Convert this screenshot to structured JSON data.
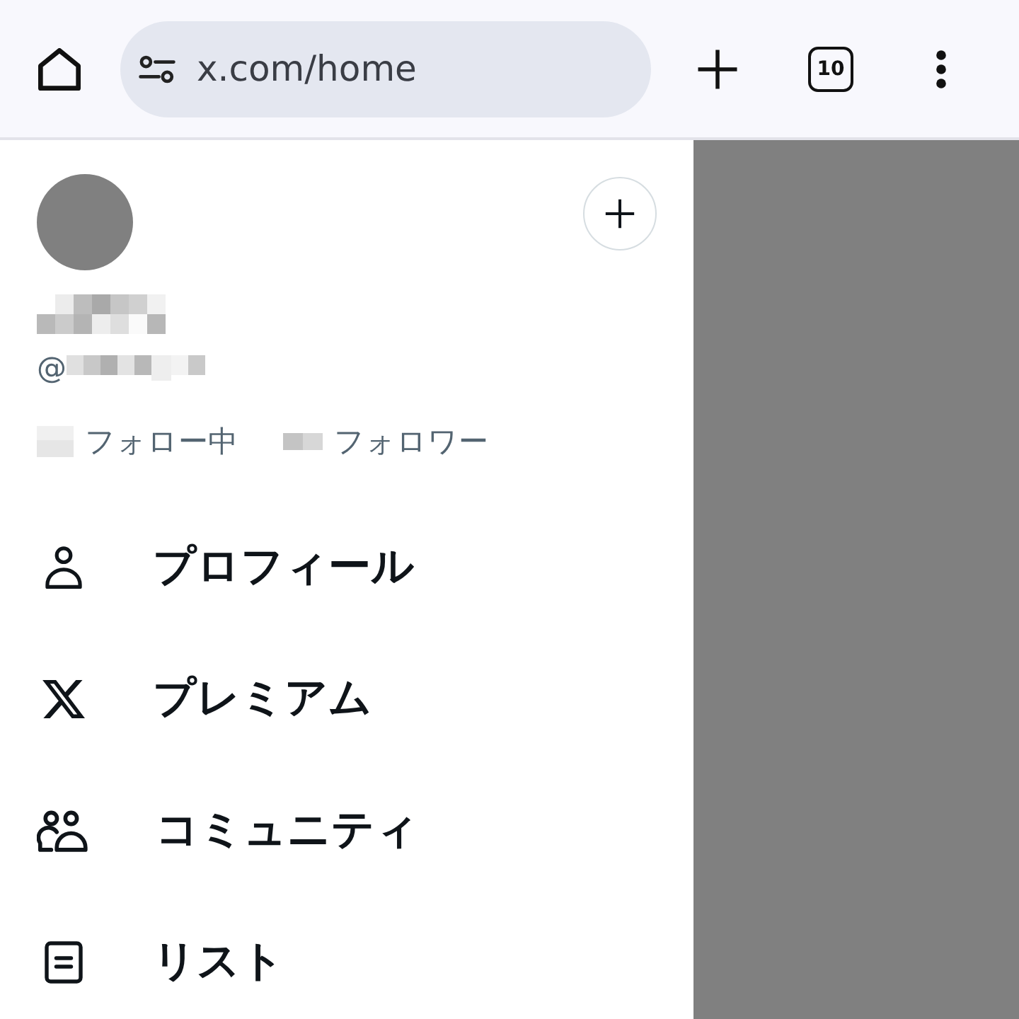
{
  "browser_toolbar": {
    "url": "x.com/home",
    "tab_count": "10"
  },
  "drawer": {
    "account": {
      "handle_prefix": "@"
    },
    "stats": [
      {
        "label": "フォロー中"
      },
      {
        "label": "フォロワー"
      }
    ],
    "menu": [
      {
        "kind": "profile",
        "label": "プロフィール"
      },
      {
        "kind": "premium",
        "label": "プレミアム"
      },
      {
        "kind": "communities",
        "label": "コミュニティ"
      },
      {
        "kind": "lists",
        "label": "リスト"
      }
    ]
  }
}
